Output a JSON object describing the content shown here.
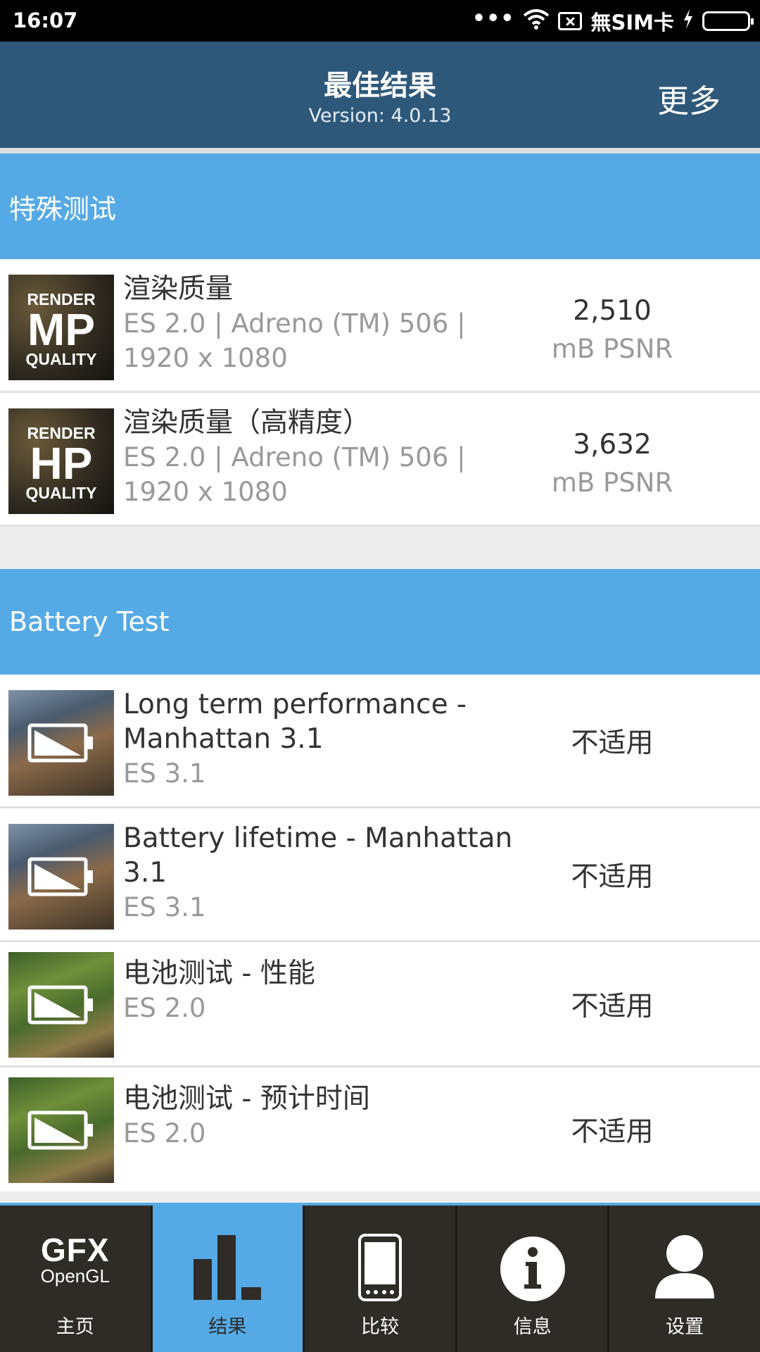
{
  "status_bar": {
    "time": "16:07",
    "carrier": "無SIM卡",
    "icons": [
      "more-dots-icon",
      "wifi-icon",
      "no-sim-icon",
      "charging-icon",
      "battery-icon"
    ]
  },
  "header": {
    "title": "最佳结果",
    "version": "Version: 4.0.13",
    "more_label": "更多"
  },
  "sections": {
    "special": {
      "title": "特殊测试",
      "rows": [
        {
          "thumb_top": "RENDER",
          "thumb_main": "MP",
          "thumb_bottom": "QUALITY",
          "name": "渲染质量",
          "spec_1": "ES 2.0 | Adreno (TM) 506 |",
          "spec_2": "1920 x 1080",
          "score": "2,510",
          "unit": "mB PSNR"
        },
        {
          "thumb_top": "RENDER",
          "thumb_main": "HP",
          "thumb_bottom": "QUALITY",
          "name": "渲染质量（高精度）",
          "spec_1": "ES 2.0 | Adreno (TM) 506 |",
          "spec_2": "1920 x 1080",
          "score": "3,632",
          "unit": "mB PSNR"
        }
      ]
    },
    "battery": {
      "title": "Battery Test",
      "rows": [
        {
          "name_1": "Long term performance -",
          "name_2": "Manhattan 3.1",
          "spec": "ES 3.1",
          "result": "不适用"
        },
        {
          "name_1": "Battery lifetime - Manhattan",
          "name_2": "3.1",
          "spec": "ES 3.1",
          "result": "不适用"
        },
        {
          "name_1": "电池测试 - 性能",
          "spec": "ES 2.0",
          "result": "不适用"
        },
        {
          "name_1": "电池测试 - 预计时间",
          "spec": "ES 2.0",
          "result": "不适用"
        }
      ]
    }
  },
  "nav": {
    "items": [
      {
        "label": "主页",
        "icon": "gfx-opengl-logo",
        "logo_top": "GFX",
        "logo_bottom": "OpenGL"
      },
      {
        "label": "结果",
        "icon": "bar-chart-icon",
        "active": true
      },
      {
        "label": "比较",
        "icon": "phone-icon"
      },
      {
        "label": "信息",
        "icon": "info-icon"
      },
      {
        "label": "设置",
        "icon": "user-icon"
      }
    ]
  },
  "colors": {
    "app_bar": "#2d587a",
    "section_header": "#55aae6",
    "nav_bg": "#2f2b26",
    "nav_active": "#55aae6",
    "battery_level": "#6fd33a"
  }
}
